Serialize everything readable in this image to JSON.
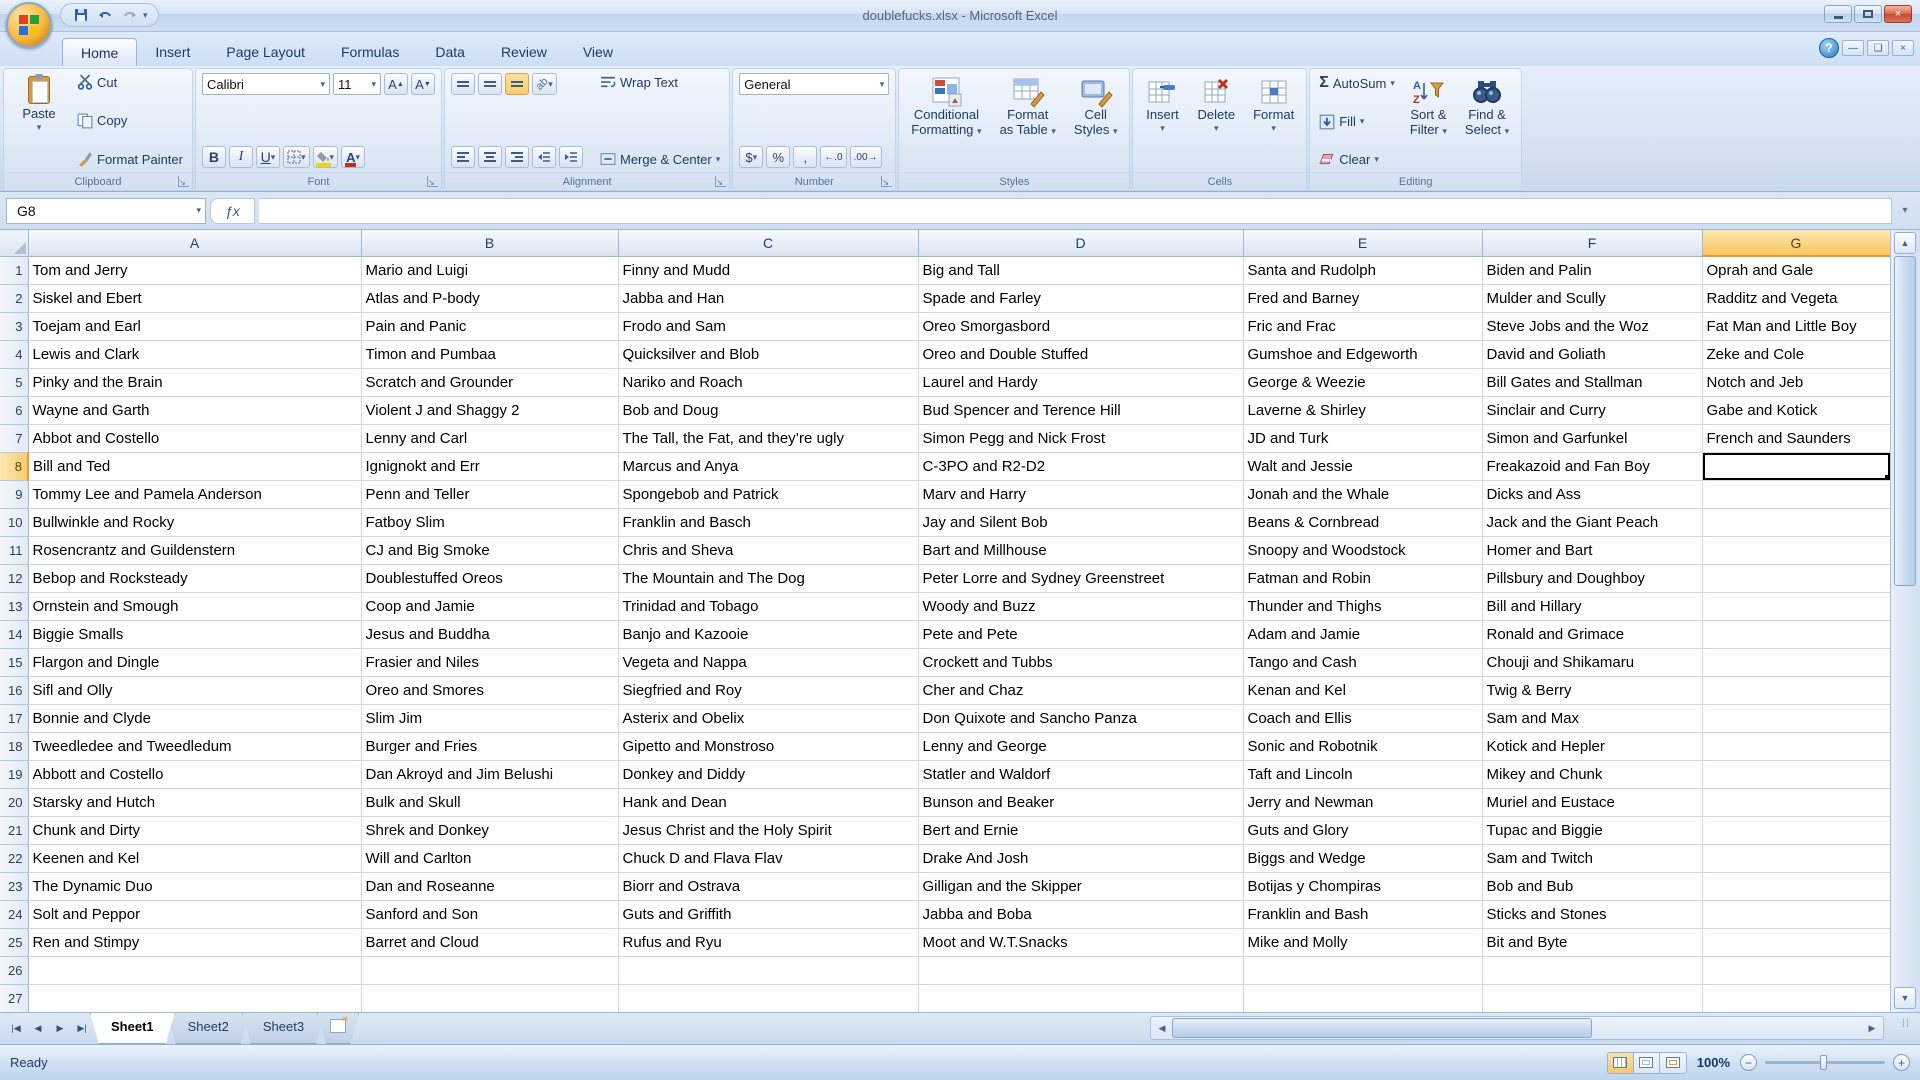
{
  "window": {
    "title": "doublefucks.xlsx - Microsoft Excel"
  },
  "ribbon": {
    "tabs": [
      "Home",
      "Insert",
      "Page Layout",
      "Formulas",
      "Data",
      "Review",
      "View"
    ],
    "active_tab": "Home",
    "groups": {
      "clipboard": {
        "label": "Clipboard",
        "paste": "Paste",
        "cut": "Cut",
        "copy": "Copy",
        "format_painter": "Format Painter"
      },
      "font": {
        "label": "Font",
        "font_name": "Calibri",
        "font_size": "11",
        "bold": "B",
        "italic": "I",
        "underline": "U"
      },
      "alignment": {
        "label": "Alignment",
        "wrap_text": "Wrap Text",
        "merge_center": "Merge & Center"
      },
      "number": {
        "label": "Number",
        "format": "General",
        "currency": "$",
        "percent": "%",
        "comma": ","
      },
      "styles": {
        "label": "Styles",
        "conditional_1": "Conditional",
        "conditional_2": "Formatting",
        "format_table_1": "Format",
        "format_table_2": "as Table",
        "cell_styles_1": "Cell",
        "cell_styles_2": "Styles"
      },
      "cells": {
        "label": "Cells",
        "insert": "Insert",
        "delete": "Delete",
        "format": "Format"
      },
      "editing": {
        "label": "Editing",
        "autosum": "AutoSum",
        "fill": "Fill",
        "clear": "Clear",
        "sort_1": "Sort &",
        "sort_2": "Filter",
        "find_1": "Find &",
        "find_2": "Select"
      }
    }
  },
  "formula_bar": {
    "name_box": "G8",
    "fx_label": "ƒx"
  },
  "sheet": {
    "columns": [
      "A",
      "B",
      "C",
      "D",
      "E",
      "F",
      "G"
    ],
    "visible_rows": 27,
    "selected_cell": "G8",
    "selected_column": "G",
    "selected_row": 8,
    "data": {
      "A": [
        "Tom and Jerry",
        "Siskel and Ebert",
        "Toejam and Earl",
        "Lewis and Clark",
        "Pinky and the Brain",
        "Wayne and Garth",
        "Abbot and Costello",
        "Bill and Ted",
        "Tommy Lee and Pamela Anderson",
        "Bullwinkle and Rocky",
        "Rosencrantz and Guildenstern",
        "Bebop and Rocksteady",
        "Ornstein and Smough",
        "Biggie Smalls",
        "Flargon and Dingle",
        "Sifl and Olly",
        "Bonnie and Clyde",
        "Tweedledee and Tweedledum",
        "Abbott and Costello",
        "Starsky and Hutch",
        "Chunk and Dirty",
        "Keenen and Kel",
        "The Dynamic Duo",
        "Solt and Peppor",
        "Ren and Stimpy"
      ],
      "B": [
        "Mario and Luigi",
        "Atlas and P-body",
        "Pain and Panic",
        "Timon and Pumbaa",
        "Scratch and Grounder",
        "Violent J and Shaggy 2",
        "Lenny and Carl",
        "Ignignokt and Err",
        "Penn and Teller",
        "Fatboy Slim",
        "CJ and Big Smoke",
        "Doublestuffed Oreos",
        "Coop and Jamie",
        "Jesus and Buddha",
        "Frasier and Niles",
        "Oreo and Smores",
        "Slim Jim",
        "Burger and Fries",
        "Dan Akroyd and Jim Belushi",
        "Bulk and Skull",
        "Shrek and Donkey",
        "Will and Carlton",
        "Dan and Roseanne",
        "Sanford and Son",
        "Barret and Cloud"
      ],
      "C": [
        "Finny and Mudd",
        "Jabba and Han",
        "Frodo and Sam",
        "Quicksilver and Blob",
        "Nariko and Roach",
        "Bob and Doug",
        "The Tall, the Fat, and they’re ugly",
        "Marcus and Anya",
        "Spongebob and Patrick",
        "Franklin and Basch",
        "Chris and Sheva",
        "The Mountain and The Dog",
        "Trinidad and Tobago",
        "Banjo and Kazooie",
        "Vegeta and Nappa",
        "Siegfried and Roy",
        "Asterix and Obelix",
        "Gipetto and Monstroso",
        "Donkey and Diddy",
        "Hank and Dean",
        "Jesus Christ and the Holy Spirit",
        "Chuck D and Flava Flav",
        "Biorr and Ostrava",
        "Guts and Griffith",
        "Rufus and Ryu"
      ],
      "D": [
        "Big and Tall",
        "Spade and Farley",
        "Oreo Smorgasbord",
        "Oreo and Double Stuffed",
        "Laurel and Hardy",
        "Bud Spencer and Terence Hill",
        "Simon Pegg and Nick Frost",
        "C-3PO and R2-D2",
        "Marv and Harry",
        "Jay and Silent Bob",
        "Bart and Millhouse",
        "Peter Lorre and Sydney Greenstreet",
        "Woody and Buzz",
        "Pete and Pete",
        "Crockett and Tubbs",
        "Cher and Chaz",
        "Don Quixote and Sancho Panza",
        "Lenny and George",
        "Statler and Waldorf",
        "Bunson and Beaker",
        "Bert and Ernie",
        "Drake And Josh",
        "Gilligan and the Skipper",
        "Jabba and Boba",
        "Moot and W.T.Snacks"
      ],
      "E": [
        "Santa and Rudolph",
        "Fred and Barney",
        "Fric and Frac",
        "Gumshoe and Edgeworth",
        "George & Weezie",
        "Laverne & Shirley",
        "JD and Turk",
        "Walt and Jessie",
        "Jonah and the Whale",
        "Beans & Cornbread",
        "Snoopy and Woodstock",
        "Fatman and Robin",
        "Thunder and Thighs",
        "Adam and Jamie",
        "Tango and Cash",
        "Kenan and Kel",
        "Coach and Ellis",
        "Sonic and Robotnik",
        "Taft and Lincoln",
        "Jerry and Newman",
        "Guts and Glory",
        "Biggs and Wedge",
        "Botijas y Chompiras",
        "Franklin and Bash",
        "Mike and Molly"
      ],
      "F": [
        "Biden and Palin",
        "Mulder and Scully",
        "Steve Jobs and the Woz",
        "David and Goliath",
        "Bill Gates and Stallman",
        "Sinclair and Curry",
        "Simon and Garfunkel",
        "Freakazoid and Fan Boy",
        "Dicks and Ass",
        "Jack and the Giant Peach",
        "Homer and Bart",
        "Pillsbury and Doughboy",
        "Bill and Hillary",
        "Ronald and Grimace",
        "Chouji and Shikamaru",
        "Twig & Berry",
        "Sam and Max",
        "Kotick and Hepler",
        "Mikey and Chunk",
        "Muriel and Eustace",
        "Tupac and Biggie",
        "Sam and Twitch",
        "Bob and Bub",
        "Sticks and Stones",
        "Bit and Byte"
      ],
      "G": [
        "Oprah and Gale",
        "Radditz and Vegeta",
        "Fat Man and Little Boy",
        "Zeke and Cole",
        "Notch and Jeb",
        "Gabe and Kotick",
        "French and Saunders"
      ]
    }
  },
  "sheet_tabs": {
    "sheets": [
      "Sheet1",
      "Sheet2",
      "Sheet3"
    ],
    "active": "Sheet1"
  },
  "status_bar": {
    "mode": "Ready",
    "zoom_level": "100%"
  },
  "colors": {
    "accent_selection": "#f9c75f",
    "selection_border": "#ef9730",
    "grid_line": "#d0d7e5",
    "header_border": "#9eb6ce"
  }
}
